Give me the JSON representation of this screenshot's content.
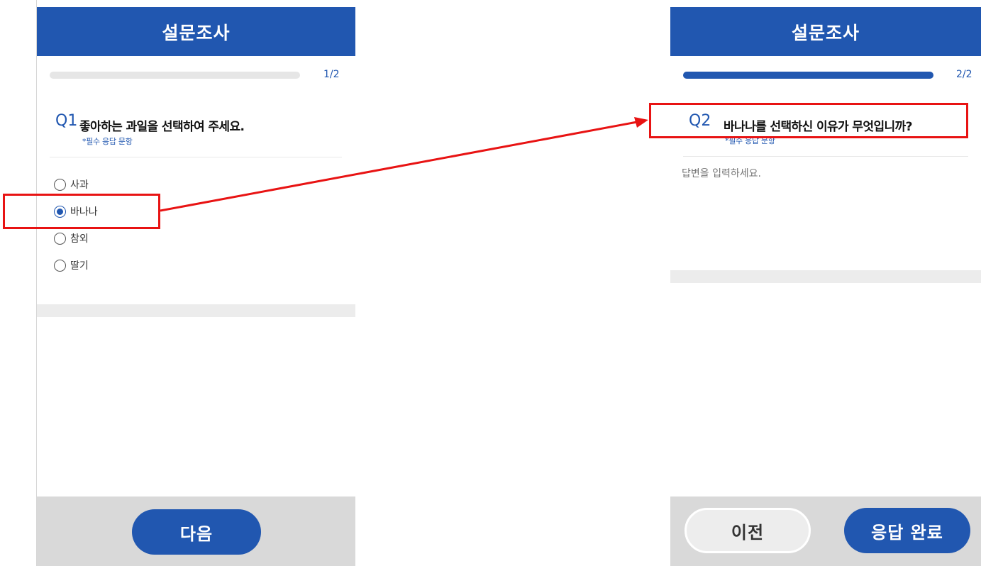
{
  "screen1": {
    "header_title": "설문조사",
    "progress_text": "1/2",
    "progress": 0.0,
    "question_number": "Q1",
    "question_text": "좋아하는 과일을 선택하여 주세요.",
    "required_note": "*필수 응답 문항",
    "options": [
      {
        "label": "사과",
        "selected": false
      },
      {
        "label": "바나나",
        "selected": true
      },
      {
        "label": "참외",
        "selected": false
      },
      {
        "label": "딸기",
        "selected": false
      }
    ],
    "next_button": "다음"
  },
  "screen2": {
    "header_title": "설문조사",
    "progress_text": "2/2",
    "progress": 1.0,
    "question_number": "Q2",
    "question_text": "바나나를 선택하신 이유가 무엇입니까?",
    "required_note": "*필수 응답 문항",
    "answer_placeholder": "답변을 입력하세요.",
    "prev_button": "이전",
    "submit_button": "응답 완료"
  },
  "colors": {
    "primary": "#2157b0",
    "annotation": "#e81313",
    "footer": "#d9d9d9"
  }
}
